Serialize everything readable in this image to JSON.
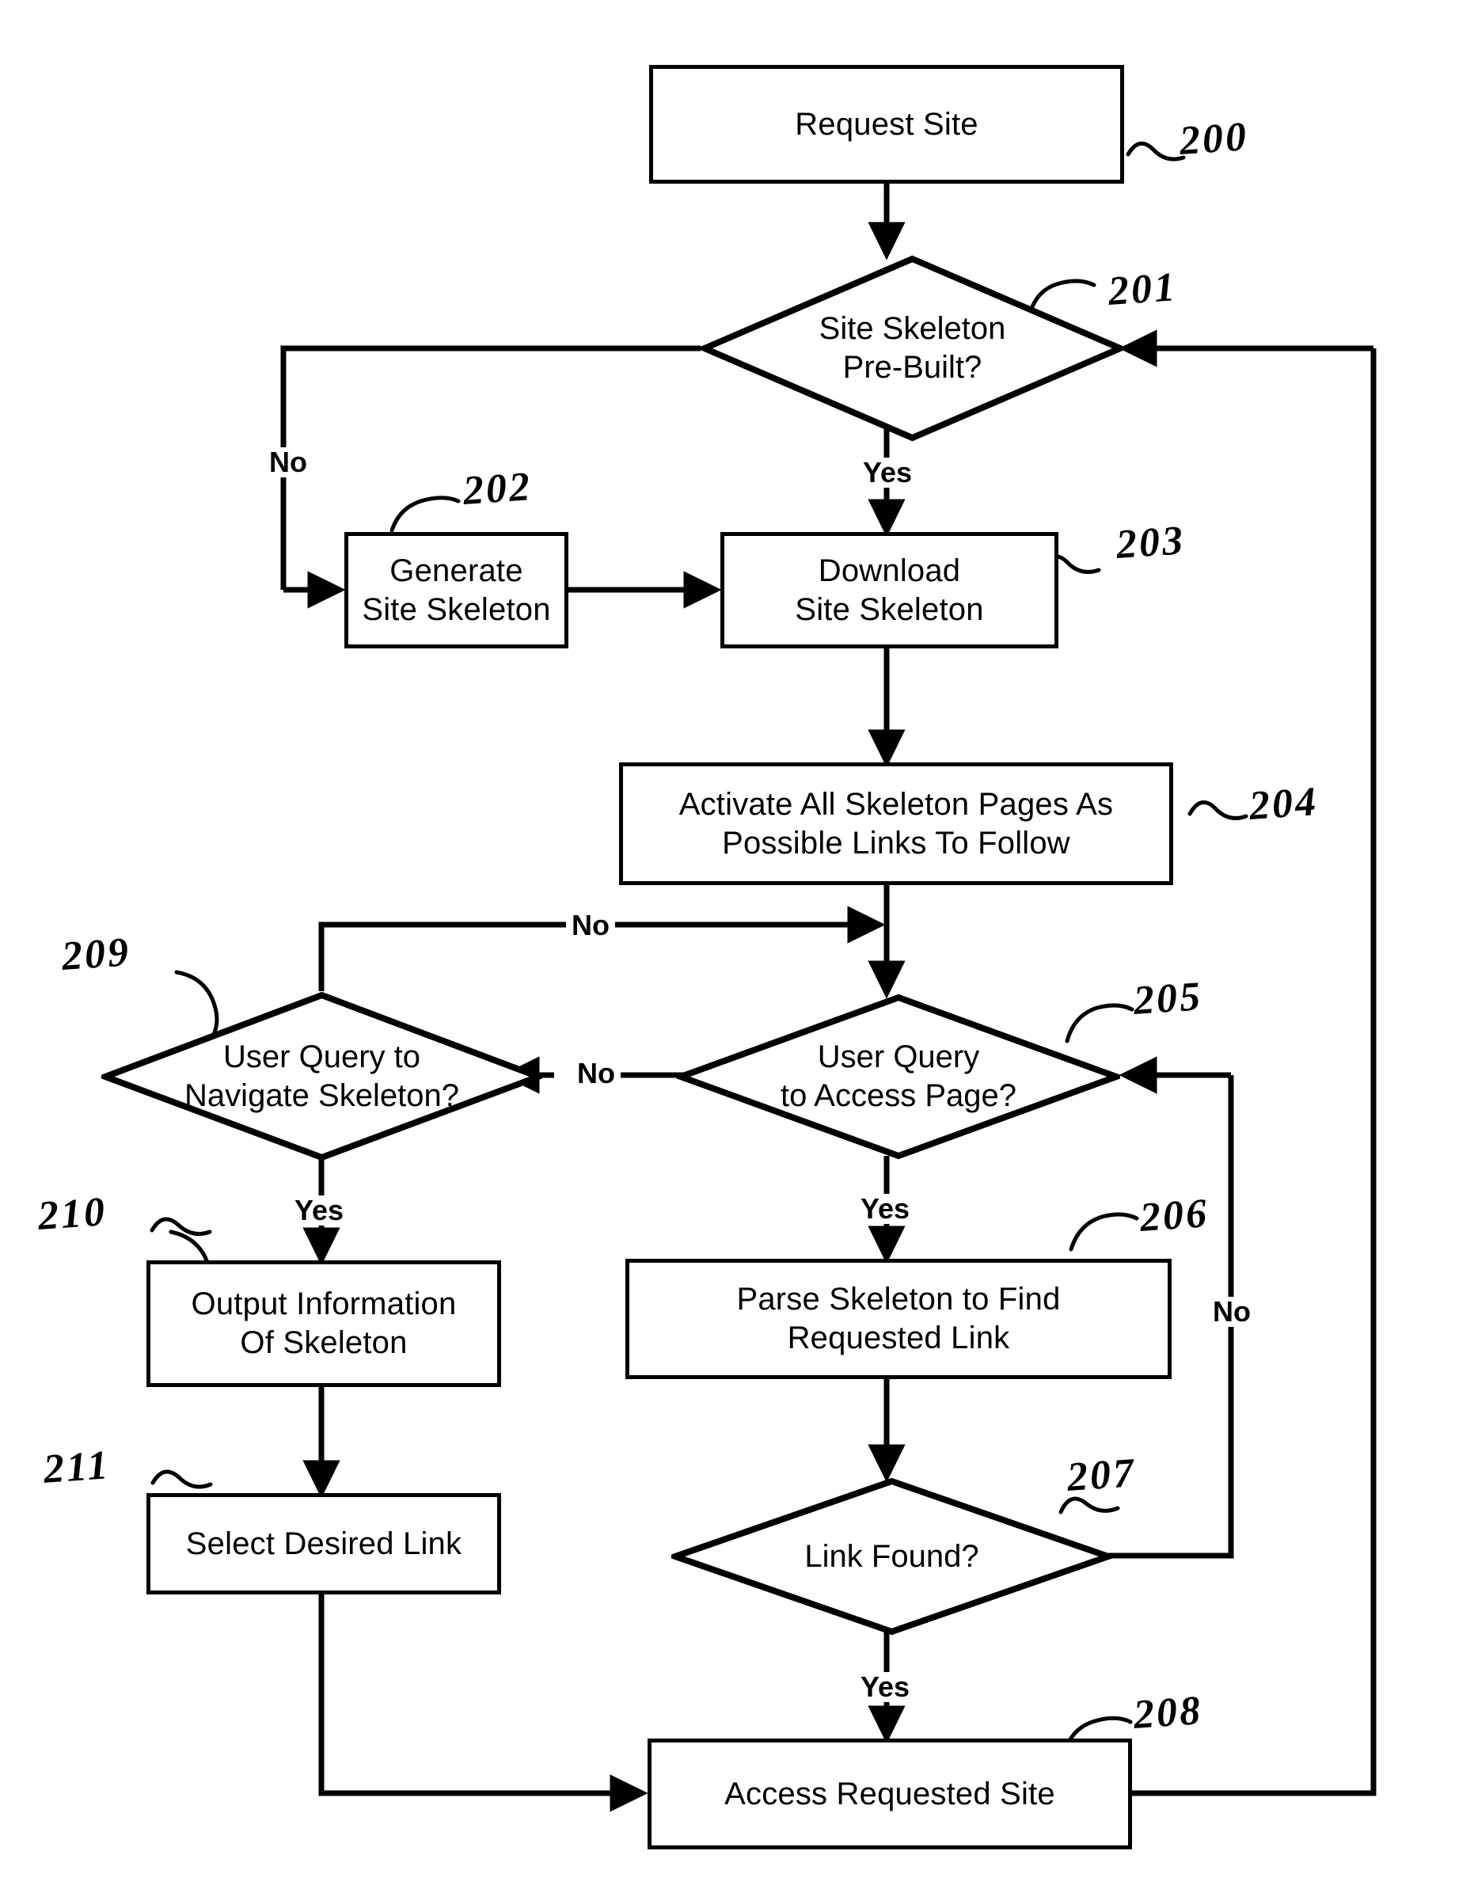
{
  "figure": {
    "kind": "patent-flowchart",
    "background_color": "#ffffff",
    "line_color": "#000000"
  },
  "nodes": {
    "request_site": {
      "label": "Request Site",
      "shape": "process",
      "ref": "200"
    },
    "site_skeleton_prebuilt": {
      "label": "Site Skeleton\nPre-Built?",
      "shape": "decision",
      "ref": "201"
    },
    "generate_site_skeleton": {
      "label": "Generate\nSite Skeleton",
      "shape": "process",
      "ref": "202"
    },
    "download_site_skeleton": {
      "label": "Download\nSite Skeleton",
      "shape": "process",
      "ref": "203"
    },
    "activate_skeleton_pages": {
      "label": "Activate All Skeleton Pages As\nPossible Links To Follow",
      "shape": "process",
      "ref": "204"
    },
    "user_query_access_page": {
      "label": "User Query\nto Access Page?",
      "shape": "decision",
      "ref": "205"
    },
    "parse_skeleton": {
      "label": "Parse Skeleton to Find\nRequested Link",
      "shape": "process",
      "ref": "206"
    },
    "link_found": {
      "label": "Link Found?",
      "shape": "decision",
      "ref": "207"
    },
    "access_requested_site": {
      "label": "Access Requested Site",
      "shape": "process",
      "ref": "208"
    },
    "user_query_navigate_skeleton": {
      "label": "User Query to\nNavigate Skeleton?",
      "shape": "decision",
      "ref": "209"
    },
    "output_information": {
      "label": "Output Information\nOf Skeleton",
      "shape": "process",
      "ref": "210"
    },
    "select_desired_link": {
      "label": "Select Desired Link",
      "shape": "process",
      "ref": "211"
    }
  },
  "edge_labels": {
    "prebuilt_no": "No",
    "prebuilt_yes": "Yes",
    "access_page_no": "No",
    "access_page_yes": "Yes",
    "navigate_no": "No",
    "navigate_yes": "Yes",
    "link_found_no": "No",
    "link_found_yes": "Yes"
  },
  "reference_numerals": {
    "n200": "200",
    "n201": "201",
    "n202": "202",
    "n203": "203",
    "n204": "204",
    "n205": "205",
    "n206": "206",
    "n207": "207",
    "n208": "208",
    "n209": "209",
    "n210": "210",
    "n211": "211"
  }
}
